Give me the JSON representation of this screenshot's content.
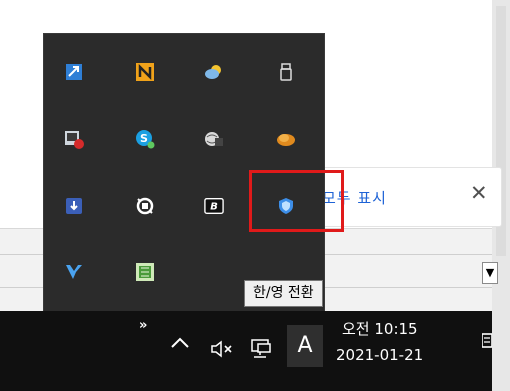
{
  "background_app": {
    "notification": {
      "show_all_label": "모두 표시",
      "close_glyph": "✕"
    },
    "scroll_down_glyph": "▼"
  },
  "tray_flyout": {
    "icons": [
      "app-blue-arrow-icon",
      "onenote-n-icon",
      "weather-app-icon",
      "usb-drive-icon",
      "red-shield-app-icon",
      "skype-icon",
      "network-globe-icon",
      "orange-cloud-icon",
      "download-arrow-icon",
      "capture-tool-icon",
      "b-app-icon",
      "security-shield-icon",
      "vs-logo-icon",
      "green-app-icon"
    ]
  },
  "tooltip": {
    "text": "한/영 전환"
  },
  "taskbar": {
    "overflow_glyph": "»",
    "ime_mode": "A",
    "time": "오전 10:15",
    "date": "2021-01-21"
  },
  "colors": {
    "highlight": "#e01a1a",
    "taskbar": "#101010",
    "flyout": "#2b2b2b"
  }
}
